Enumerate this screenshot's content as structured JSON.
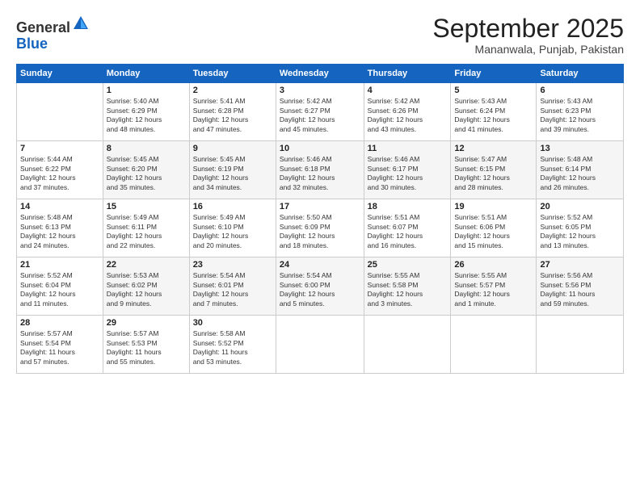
{
  "logo": {
    "general": "General",
    "blue": "Blue"
  },
  "header": {
    "month": "September 2025",
    "location": "Mananwala, Punjab, Pakistan"
  },
  "days_of_week": [
    "Sunday",
    "Monday",
    "Tuesday",
    "Wednesday",
    "Thursday",
    "Friday",
    "Saturday"
  ],
  "weeks": [
    [
      {
        "day": "",
        "info": ""
      },
      {
        "day": "1",
        "info": "Sunrise: 5:40 AM\nSunset: 6:29 PM\nDaylight: 12 hours\nand 48 minutes."
      },
      {
        "day": "2",
        "info": "Sunrise: 5:41 AM\nSunset: 6:28 PM\nDaylight: 12 hours\nand 47 minutes."
      },
      {
        "day": "3",
        "info": "Sunrise: 5:42 AM\nSunset: 6:27 PM\nDaylight: 12 hours\nand 45 minutes."
      },
      {
        "day": "4",
        "info": "Sunrise: 5:42 AM\nSunset: 6:26 PM\nDaylight: 12 hours\nand 43 minutes."
      },
      {
        "day": "5",
        "info": "Sunrise: 5:43 AM\nSunset: 6:24 PM\nDaylight: 12 hours\nand 41 minutes."
      },
      {
        "day": "6",
        "info": "Sunrise: 5:43 AM\nSunset: 6:23 PM\nDaylight: 12 hours\nand 39 minutes."
      }
    ],
    [
      {
        "day": "7",
        "info": "Sunrise: 5:44 AM\nSunset: 6:22 PM\nDaylight: 12 hours\nand 37 minutes."
      },
      {
        "day": "8",
        "info": "Sunrise: 5:45 AM\nSunset: 6:20 PM\nDaylight: 12 hours\nand 35 minutes."
      },
      {
        "day": "9",
        "info": "Sunrise: 5:45 AM\nSunset: 6:19 PM\nDaylight: 12 hours\nand 34 minutes."
      },
      {
        "day": "10",
        "info": "Sunrise: 5:46 AM\nSunset: 6:18 PM\nDaylight: 12 hours\nand 32 minutes."
      },
      {
        "day": "11",
        "info": "Sunrise: 5:46 AM\nSunset: 6:17 PM\nDaylight: 12 hours\nand 30 minutes."
      },
      {
        "day": "12",
        "info": "Sunrise: 5:47 AM\nSunset: 6:15 PM\nDaylight: 12 hours\nand 28 minutes."
      },
      {
        "day": "13",
        "info": "Sunrise: 5:48 AM\nSunset: 6:14 PM\nDaylight: 12 hours\nand 26 minutes."
      }
    ],
    [
      {
        "day": "14",
        "info": "Sunrise: 5:48 AM\nSunset: 6:13 PM\nDaylight: 12 hours\nand 24 minutes."
      },
      {
        "day": "15",
        "info": "Sunrise: 5:49 AM\nSunset: 6:11 PM\nDaylight: 12 hours\nand 22 minutes."
      },
      {
        "day": "16",
        "info": "Sunrise: 5:49 AM\nSunset: 6:10 PM\nDaylight: 12 hours\nand 20 minutes."
      },
      {
        "day": "17",
        "info": "Sunrise: 5:50 AM\nSunset: 6:09 PM\nDaylight: 12 hours\nand 18 minutes."
      },
      {
        "day": "18",
        "info": "Sunrise: 5:51 AM\nSunset: 6:07 PM\nDaylight: 12 hours\nand 16 minutes."
      },
      {
        "day": "19",
        "info": "Sunrise: 5:51 AM\nSunset: 6:06 PM\nDaylight: 12 hours\nand 15 minutes."
      },
      {
        "day": "20",
        "info": "Sunrise: 5:52 AM\nSunset: 6:05 PM\nDaylight: 12 hours\nand 13 minutes."
      }
    ],
    [
      {
        "day": "21",
        "info": "Sunrise: 5:52 AM\nSunset: 6:04 PM\nDaylight: 12 hours\nand 11 minutes."
      },
      {
        "day": "22",
        "info": "Sunrise: 5:53 AM\nSunset: 6:02 PM\nDaylight: 12 hours\nand 9 minutes."
      },
      {
        "day": "23",
        "info": "Sunrise: 5:54 AM\nSunset: 6:01 PM\nDaylight: 12 hours\nand 7 minutes."
      },
      {
        "day": "24",
        "info": "Sunrise: 5:54 AM\nSunset: 6:00 PM\nDaylight: 12 hours\nand 5 minutes."
      },
      {
        "day": "25",
        "info": "Sunrise: 5:55 AM\nSunset: 5:58 PM\nDaylight: 12 hours\nand 3 minutes."
      },
      {
        "day": "26",
        "info": "Sunrise: 5:55 AM\nSunset: 5:57 PM\nDaylight: 12 hours\nand 1 minute."
      },
      {
        "day": "27",
        "info": "Sunrise: 5:56 AM\nSunset: 5:56 PM\nDaylight: 11 hours\nand 59 minutes."
      }
    ],
    [
      {
        "day": "28",
        "info": "Sunrise: 5:57 AM\nSunset: 5:54 PM\nDaylight: 11 hours\nand 57 minutes."
      },
      {
        "day": "29",
        "info": "Sunrise: 5:57 AM\nSunset: 5:53 PM\nDaylight: 11 hours\nand 55 minutes."
      },
      {
        "day": "30",
        "info": "Sunrise: 5:58 AM\nSunset: 5:52 PM\nDaylight: 11 hours\nand 53 minutes."
      },
      {
        "day": "",
        "info": ""
      },
      {
        "day": "",
        "info": ""
      },
      {
        "day": "",
        "info": ""
      },
      {
        "day": "",
        "info": ""
      }
    ]
  ]
}
